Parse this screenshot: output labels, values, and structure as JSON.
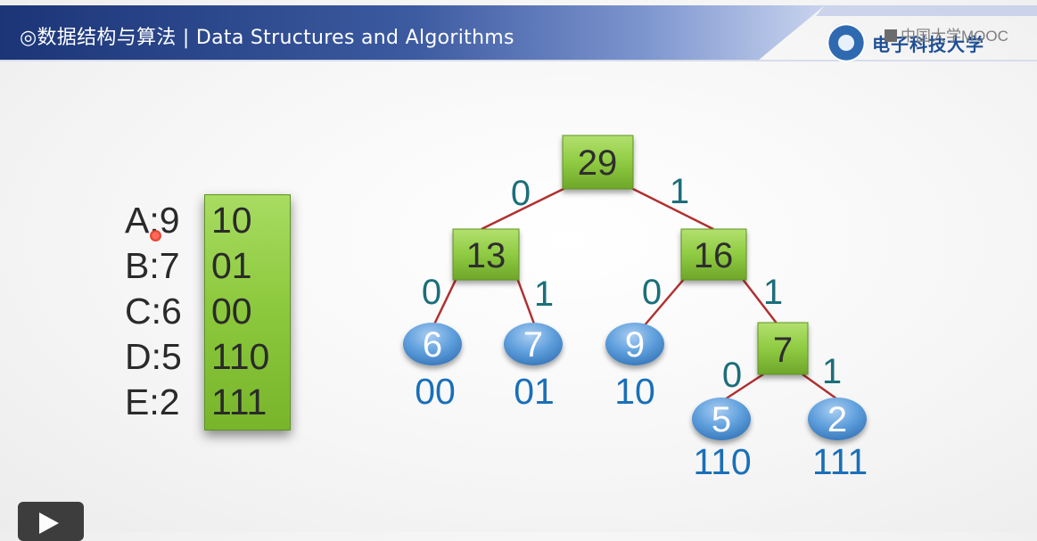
{
  "header": {
    "title": "◎数据结构与算法 | Data Structures and Algorithms",
    "university": "电子科技大学",
    "watermark": "中国大学MOOC"
  },
  "code_table": [
    {
      "letter": "A:9",
      "code": "10"
    },
    {
      "letter": "B:7",
      "code": "01"
    },
    {
      "letter": "C:6",
      "code": "00"
    },
    {
      "letter": "D:5",
      "code": "110"
    },
    {
      "letter": "E:2",
      "code": "111"
    }
  ],
  "tree": {
    "nodes": {
      "root": "29",
      "left": "13",
      "right": "16",
      "right_inner": "7",
      "leaf_6": "6",
      "leaf_7": "7",
      "leaf_9": "9",
      "leaf_5": "5",
      "leaf_2": "2"
    },
    "edge_labels": {
      "root_left": "0",
      "root_right": "1",
      "left_leaf6": "0",
      "left_leaf7": "1",
      "right_leaf9": "0",
      "right_inner": "1",
      "inner_leaf5": "0",
      "inner_leaf2": "1"
    },
    "codes": {
      "leaf_6": "00",
      "leaf_7": "01",
      "leaf_9": "10",
      "leaf_5": "110",
      "leaf_2": "111"
    }
  },
  "colors": {
    "header_dark": "#18306a",
    "header_light": "#6c86c2",
    "node_green": "#8bc83c",
    "leaf_blue": "#4a90d4",
    "edge_red": "#b03030",
    "code_blue": "#1a6fb8",
    "label_teal": "#1c6e7a"
  }
}
